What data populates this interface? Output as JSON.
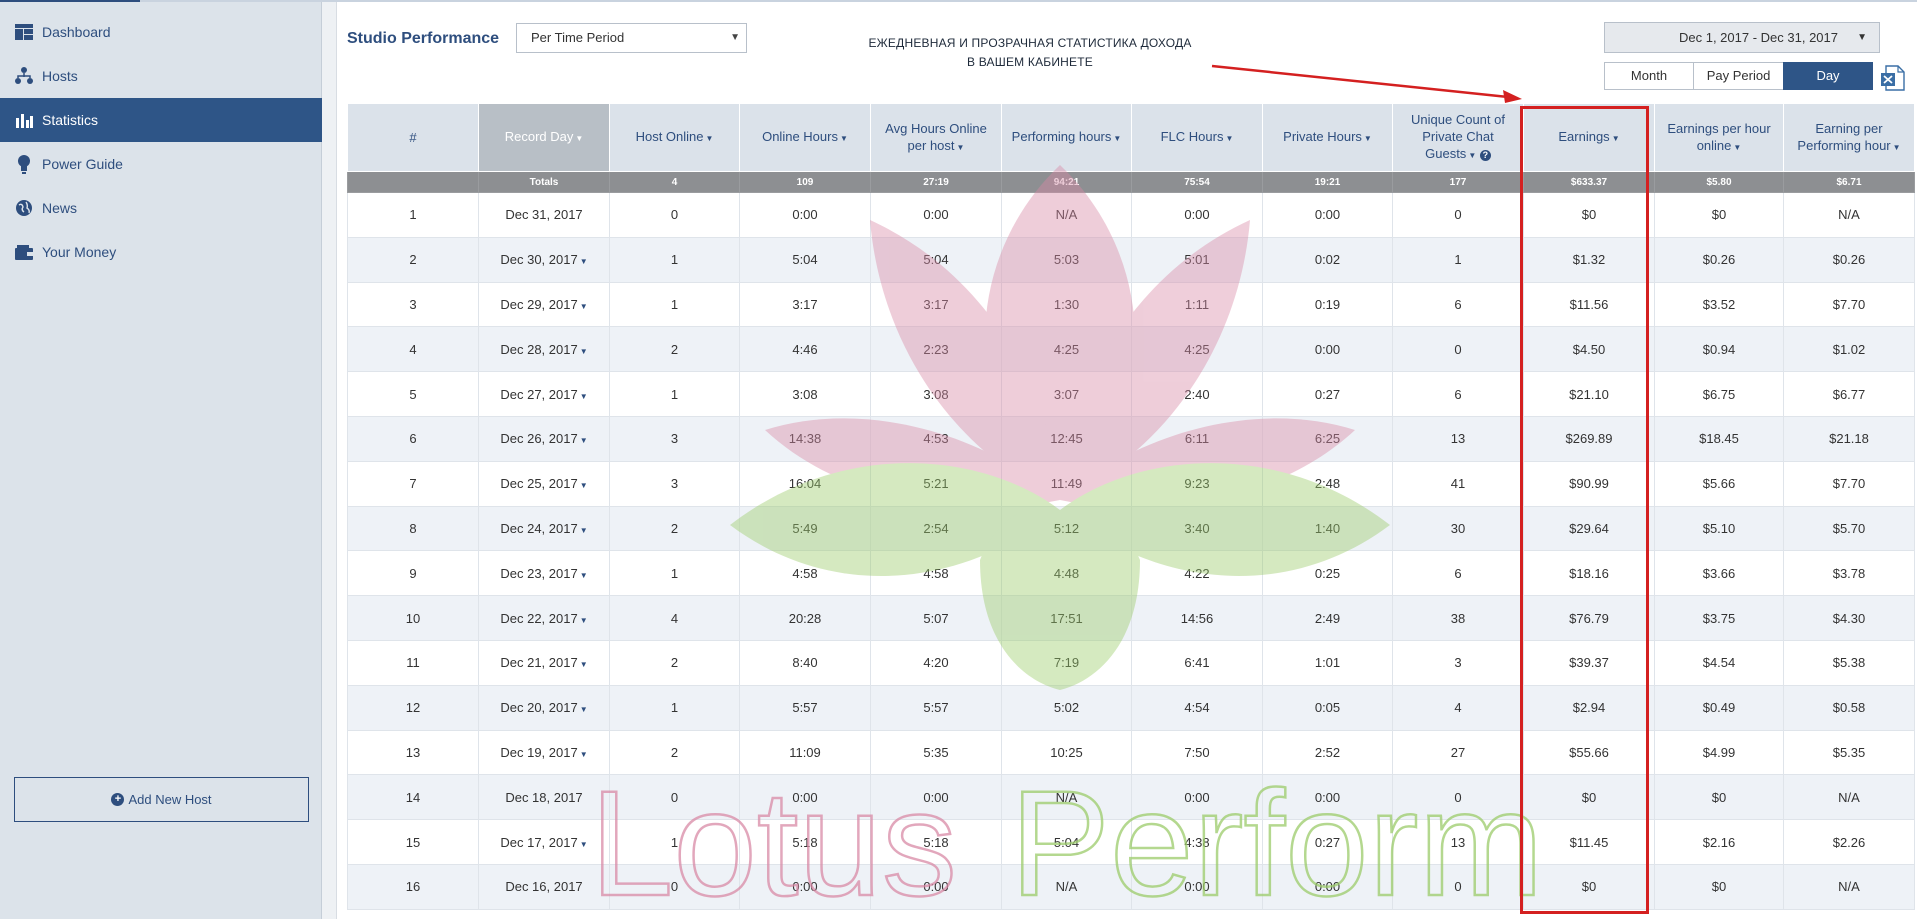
{
  "sidebar": {
    "items": [
      {
        "label": "Dashboard",
        "icon": "dashboard-icon",
        "active": false
      },
      {
        "label": "Hosts",
        "icon": "hosts-icon",
        "active": false
      },
      {
        "label": "Statistics",
        "icon": "bar-chart-icon",
        "active": true
      },
      {
        "label": "Power Guide",
        "icon": "lightbulb-icon",
        "active": false
      },
      {
        "label": "News",
        "icon": "globe-icon",
        "active": false
      },
      {
        "label": "Your Money",
        "icon": "wallet-icon",
        "active": false
      }
    ],
    "add_host_label": "Add New Host"
  },
  "header": {
    "title": "Studio Performance",
    "period_select": "Per Time Period",
    "date_range": "Dec 1, 2017 - Dec 31, 2017",
    "granularity": [
      "Month",
      "Pay Period",
      "Day"
    ],
    "granularity_active": "Day"
  },
  "annotation": {
    "line1": "ЕЖЕДНЕВНАЯ И ПРОЗРАЧНАЯ СТАТИСТИКА ДОХОДА",
    "line2": "В ВАШЕМ КАБИНЕТЕ"
  },
  "watermark": {
    "text_part1": "Lotus",
    "text_part2": "Perform"
  },
  "table": {
    "columns": [
      "#",
      "Record Day",
      "Host Online",
      "Online Hours",
      "Avg Hours Online per host",
      "Performing hours",
      "FLC Hours",
      "Private Hours",
      "Unique Count of Private Chat Guests",
      "Earnings",
      "Earnings per hour online",
      "Earning per Performing hour"
    ],
    "totals": [
      "",
      "Totals",
      "4",
      "109",
      "27:19",
      "94:21",
      "75:54",
      "19:21",
      "177",
      "$633.37",
      "$5.80",
      "$6.71"
    ],
    "rows": [
      [
        "1",
        "Dec 31, 2017",
        "0",
        "0:00",
        "0:00",
        "N/A",
        "0:00",
        "0:00",
        "0",
        "$0",
        "$0",
        "N/A"
      ],
      [
        "2",
        "Dec 30, 2017",
        "1",
        "5:04",
        "5:04",
        "5:03",
        "5:01",
        "0:02",
        "1",
        "$1.32",
        "$0.26",
        "$0.26"
      ],
      [
        "3",
        "Dec 29, 2017",
        "1",
        "3:17",
        "3:17",
        "1:30",
        "1:11",
        "0:19",
        "6",
        "$11.56",
        "$3.52",
        "$7.70"
      ],
      [
        "4",
        "Dec 28, 2017",
        "2",
        "4:46",
        "2:23",
        "4:25",
        "4:25",
        "0:00",
        "0",
        "$4.50",
        "$0.94",
        "$1.02"
      ],
      [
        "5",
        "Dec 27, 2017",
        "1",
        "3:08",
        "3:08",
        "3:07",
        "2:40",
        "0:27",
        "6",
        "$21.10",
        "$6.75",
        "$6.77"
      ],
      [
        "6",
        "Dec 26, 2017",
        "3",
        "14:38",
        "4:53",
        "12:45",
        "6:11",
        "6:25",
        "13",
        "$269.89",
        "$18.45",
        "$21.18"
      ],
      [
        "7",
        "Dec 25, 2017",
        "3",
        "16:04",
        "5:21",
        "11:49",
        "9:23",
        "2:48",
        "41",
        "$90.99",
        "$5.66",
        "$7.70"
      ],
      [
        "8",
        "Dec 24, 2017",
        "2",
        "5:49",
        "2:54",
        "5:12",
        "3:40",
        "1:40",
        "30",
        "$29.64",
        "$5.10",
        "$5.70"
      ],
      [
        "9",
        "Dec 23, 2017",
        "1",
        "4:58",
        "4:58",
        "4:48",
        "4:22",
        "0:25",
        "6",
        "$18.16",
        "$3.66",
        "$3.78"
      ],
      [
        "10",
        "Dec 22, 2017",
        "4",
        "20:28",
        "5:07",
        "17:51",
        "14:56",
        "2:49",
        "38",
        "$76.79",
        "$3.75",
        "$4.30"
      ],
      [
        "11",
        "Dec 21, 2017",
        "2",
        "8:40",
        "4:20",
        "7:19",
        "6:41",
        "1:01",
        "3",
        "$39.37",
        "$4.54",
        "$5.38"
      ],
      [
        "12",
        "Dec 20, 2017",
        "1",
        "5:57",
        "5:57",
        "5:02",
        "4:54",
        "0:05",
        "4",
        "$2.94",
        "$0.49",
        "$0.58"
      ],
      [
        "13",
        "Dec 19, 2017",
        "2",
        "11:09",
        "5:35",
        "10:25",
        "7:50",
        "2:52",
        "27",
        "$55.66",
        "$4.99",
        "$5.35"
      ],
      [
        "14",
        "Dec 18, 2017",
        "0",
        "0:00",
        "0:00",
        "N/A",
        "0:00",
        "0:00",
        "0",
        "$0",
        "$0",
        "N/A"
      ],
      [
        "15",
        "Dec 17, 2017",
        "1",
        "5:18",
        "5:18",
        "5:04",
        "4:38",
        "0:27",
        "13",
        "$11.45",
        "$2.16",
        "$2.26"
      ],
      [
        "16",
        "Dec 16, 2017",
        "0",
        "0:00",
        "0:00",
        "N/A",
        "0:00",
        "0:00",
        "0",
        "$0",
        "$0",
        "N/A"
      ]
    ],
    "row_has_dropdown": [
      false,
      true,
      true,
      true,
      true,
      true,
      true,
      true,
      true,
      true,
      true,
      true,
      true,
      false,
      true,
      false
    ]
  },
  "colors": {
    "brand": "#2e5587",
    "highlight": "#d42020",
    "watermark_pink": "#d98aa6",
    "watermark_green": "#9ccc6a"
  }
}
